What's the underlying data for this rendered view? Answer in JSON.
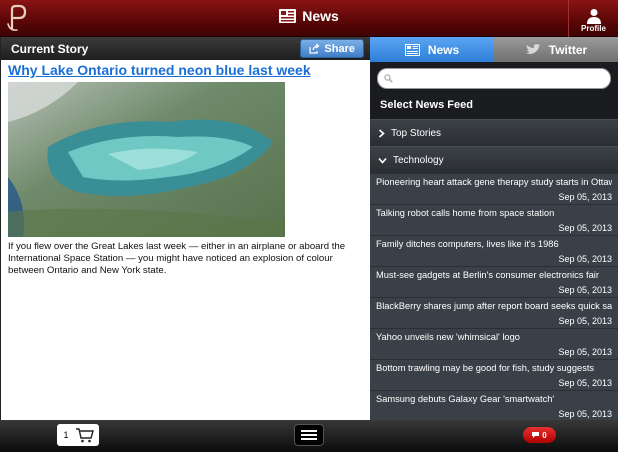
{
  "header": {
    "title": "News",
    "profile_label": "Profile"
  },
  "story": {
    "section_label": "Current Story",
    "share_label": "Share",
    "headline": "Why Lake Ontario turned neon blue last week",
    "body": "If you flew over the Great Lakes last week — either in an airplane or aboard the International Space Station — you might have noticed an explosion of colour between Ontario and New York state."
  },
  "sidebar": {
    "tabs": [
      {
        "label": "News"
      },
      {
        "label": "Twitter"
      }
    ],
    "search_placeholder": "",
    "feed_title": "Select News Feed",
    "sections": [
      {
        "label": "Top Stories"
      },
      {
        "label": "Technology"
      }
    ],
    "items": [
      {
        "title": "Pioneering heart attack gene therapy study starts in Ottawa",
        "date": "Sep 05, 2013"
      },
      {
        "title": "Talking robot calls home from space station",
        "date": "Sep 05, 2013"
      },
      {
        "title": "Family ditches computers, lives like it's 1986",
        "date": "Sep 05, 2013"
      },
      {
        "title": "Must-see gadgets at Berlin's consumer electronics fair",
        "date": "Sep 05, 2013"
      },
      {
        "title": "BlackBerry shares jump after report board seeks quick sale",
        "date": "Sep 05, 2013"
      },
      {
        "title": "Yahoo unveils new 'whimsical' logo",
        "date": "Sep 05, 2013"
      },
      {
        "title": "Bottom trawling may be good for fish, study suggests",
        "date": "Sep 05, 2013"
      },
      {
        "title": "Samsung debuts Galaxy Gear 'smartwatch'",
        "date": "Sep 05, 2013"
      }
    ]
  },
  "footer": {
    "cart_quantity": "1",
    "notification_count": "0"
  },
  "colors": {
    "header_red": "#7a0e0e",
    "tab_active": "#3d8fe0",
    "link": "#1a6fd6",
    "badge": "#d21a1a"
  }
}
